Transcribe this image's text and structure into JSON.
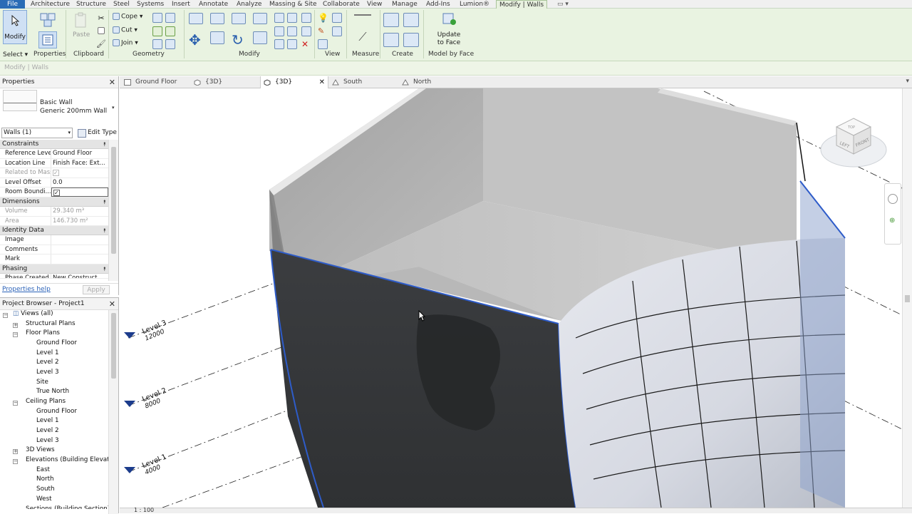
{
  "ribbon_tabs": [
    "File",
    "Architecture",
    "Structure",
    "Steel",
    "Systems",
    "Insert",
    "Annotate",
    "Analyze",
    "Massing & Site",
    "Collaborate",
    "View",
    "Manage",
    "Add-Ins",
    "Lumion®",
    "Modify | Walls"
  ],
  "ribbon": {
    "modify_label": "Modify",
    "paste_label": "Paste",
    "cope_label": "Cope",
    "cut_label": "Cut",
    "join_label": "Join",
    "update_to_face_label": "Update to Face",
    "update_line1": "Update",
    "update_line2": "to Face",
    "panels": {
      "select": "Select",
      "properties": "Properties",
      "clipboard": "Clipboard",
      "geometry": "Geometry",
      "modify": "Modify",
      "view": "View",
      "measure": "Measure",
      "create": "Create",
      "model_by_face": "Model by Face"
    }
  },
  "context_label": "Modify | Walls",
  "properties": {
    "title": "Properties",
    "family": "Basic Wall",
    "type": "Generic 200mm Wall",
    "selector": "Walls (1)",
    "edit_type": "Edit Type",
    "groups": {
      "constraints": "Constraints",
      "dimensions": "Dimensions",
      "identity": "Identity Data",
      "phasing": "Phasing"
    },
    "rows": {
      "reference_level": {
        "key": "Reference Level",
        "value": "Ground Floor"
      },
      "location_line": {
        "key": "Location Line",
        "value": "Finish Face: Ext..."
      },
      "related_to_mass": {
        "key": "Related to Mass"
      },
      "level_offset": {
        "key": "Level Offset",
        "value": "0.0"
      },
      "room_bounding": {
        "key": "Room Boundi..."
      },
      "volume": {
        "key": "Volume",
        "value": "29.340 m³"
      },
      "area": {
        "key": "Area",
        "value": "146.730 m²"
      },
      "image": {
        "key": "Image",
        "value": ""
      },
      "comments": {
        "key": "Comments",
        "value": ""
      },
      "mark": {
        "key": "Mark",
        "value": ""
      },
      "phase_created": {
        "key": "Phase Created",
        "value": "New Construct..."
      }
    },
    "help_link": "Properties help",
    "apply": "Apply"
  },
  "browser": {
    "title": "Project Browser - Project1",
    "items": {
      "views_all": "Views (all)",
      "structural_plans": "Structural Plans",
      "floor_plans": "Floor Plans",
      "fp_ground": "Ground Floor",
      "fp_l1": "Level 1",
      "fp_l2": "Level 2",
      "fp_l3": "Level 3",
      "fp_site": "Site",
      "fp_true_north": "True North",
      "ceiling_plans": "Ceiling Plans",
      "cp_ground": "Ground Floor",
      "cp_l1": "Level 1",
      "cp_l2": "Level 2",
      "cp_l3": "Level 3",
      "views_3d": "3D Views",
      "elevations": "Elevations (Building Elevation",
      "el_east": "East",
      "el_north": "North",
      "el_south": "South",
      "el_west": "West",
      "sections": "Sections (Building Section)"
    }
  },
  "view_tabs": {
    "ground_floor": "Ground Floor",
    "three_d_1": "{3D}",
    "three_d_2": "{3D}",
    "south": "South",
    "north": "North"
  },
  "levels": {
    "l3": {
      "name": "Level 3",
      "elev": "12000"
    },
    "l2": {
      "name": "Level 2",
      "elev": "8000"
    },
    "l1": {
      "name": "Level 1",
      "elev": "4000"
    }
  },
  "viewcube": {
    "front": "FRONT",
    "left": "LEFT",
    "top": "TOP"
  },
  "scale": "1 : 100",
  "colors": {
    "ribbon_bg": "#e9f3e1",
    "file_tab": "#2a6cb6",
    "selection_blue": "#2e5cc9",
    "wall_dark": "#3a3c3e"
  }
}
